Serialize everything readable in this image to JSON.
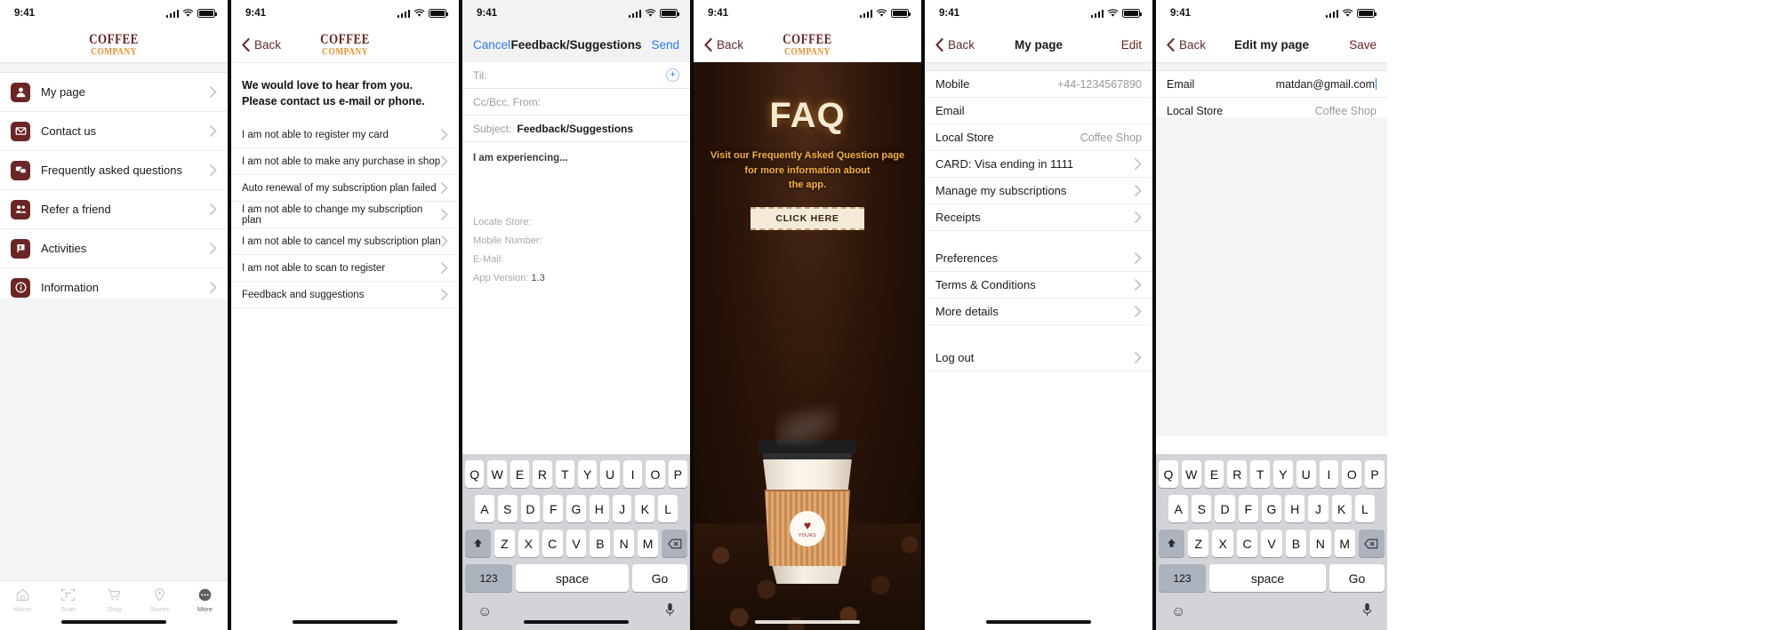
{
  "brand": {
    "line1": "COFFEE",
    "line2": "COMPANY",
    "color1": "#6b2525",
    "color2": "#e8912e"
  },
  "status": {
    "time": "9:41"
  },
  "common": {
    "back_label": "Back"
  },
  "panel_menu": {
    "items": [
      {
        "label": "My page",
        "icon": "person-icon"
      },
      {
        "label": "Contact us",
        "icon": "envelope-icon"
      },
      {
        "label": "Frequently asked questions",
        "icon": "chat-bubbles-icon"
      },
      {
        "label": "Refer a friend",
        "icon": "people-icon"
      },
      {
        "label": "Activities",
        "icon": "flag-icon"
      },
      {
        "label": "Information",
        "icon": "info-icon"
      }
    ],
    "tabs": [
      {
        "label": "Home",
        "icon": "home-icon",
        "active": false
      },
      {
        "label": "Scan",
        "icon": "qr-scan-icon",
        "active": false
      },
      {
        "label": "Shop",
        "icon": "cart-icon",
        "active": false
      },
      {
        "label": "Stores",
        "icon": "pin-icon",
        "active": false
      },
      {
        "label": "More",
        "icon": "more-dots-icon",
        "active": true
      }
    ]
  },
  "panel_contact": {
    "blurb_line1": "We would love to hear from you.",
    "blurb_line2": "Please contact us e-mail or phone.",
    "items": [
      "I am not able to register my card",
      "I am not able to make any purchase in shop",
      "Auto renewal of my subscription plan failed",
      "I am not able to change my subscription plan",
      "I am not able to cancel my subscription plan",
      "I am not able to scan to register",
      "Feedback and suggestions"
    ]
  },
  "panel_mail": {
    "cancel_label": "Cancel",
    "title": "Feedback/Suggestions",
    "send_label": "Send",
    "to_label": "Til:",
    "to_value": "",
    "ccbcc_label": "Cc/Bcc, From:",
    "ccbcc_value": "",
    "subject_label": "Subject:",
    "subject_value": "Feedback/Suggestions",
    "body": "I am experiencing...",
    "meta": [
      {
        "key": "Locate Store:",
        "value": ""
      },
      {
        "key": "Mobile Number:",
        "value": ""
      },
      {
        "key": "E-Mail:",
        "value": ""
      },
      {
        "key": "App Version:",
        "value": "1.3"
      }
    ],
    "add_icon": "plus-circle-icon"
  },
  "panel_faq": {
    "title": "FAQ",
    "subtitle_line1": "Visit our Frequently Asked Question page",
    "subtitle_line2": "for more information about",
    "subtitle_line3": "the app.",
    "button_label": "CLICK HERE",
    "cup_badge_top": "♥",
    "cup_badge_text": "YOURS"
  },
  "panel_mypage": {
    "title": "My page",
    "edit_label": "Edit",
    "rows": [
      {
        "label": "Mobile",
        "value": "+44-1234567890",
        "chevron": false
      },
      {
        "label": "Email",
        "value": "",
        "chevron": false
      },
      {
        "label": "Local Store",
        "value": "Coffee Shop",
        "chevron": false
      },
      {
        "label": "CARD: Visa ending in 1111",
        "value": "",
        "chevron": true
      },
      {
        "label": "Manage my subscriptions",
        "value": "",
        "chevron": true
      },
      {
        "label": "Receipts",
        "value": "",
        "chevron": true
      }
    ],
    "rows2": [
      {
        "label": "Preferences",
        "value": "",
        "chevron": true
      },
      {
        "label": "Terms & Conditions",
        "value": "",
        "chevron": true
      },
      {
        "label": "More details",
        "value": "",
        "chevron": true
      }
    ],
    "logout": {
      "label": "Log out",
      "chevron": true
    }
  },
  "panel_edit": {
    "title": "Edit my page",
    "save_label": "Save",
    "rows": [
      {
        "label": "Email",
        "value": "matdan@gmail.com",
        "editing": true
      },
      {
        "label": "Local Store",
        "value": "Coffee Shop",
        "editing": false
      }
    ]
  },
  "keyboard": {
    "row1": [
      "Q",
      "W",
      "E",
      "R",
      "T",
      "Y",
      "U",
      "I",
      "O",
      "P"
    ],
    "row2": [
      "A",
      "S",
      "D",
      "F",
      "G",
      "H",
      "J",
      "K",
      "L"
    ],
    "row3": [
      "Z",
      "X",
      "C",
      "V",
      "B",
      "N",
      "M"
    ],
    "shift": "shift-icon",
    "backspace": "backspace-icon",
    "num_label": "123",
    "space_label": "space",
    "go_label": "Go",
    "emoji": "emoji-icon",
    "mic": "microphone-icon"
  }
}
